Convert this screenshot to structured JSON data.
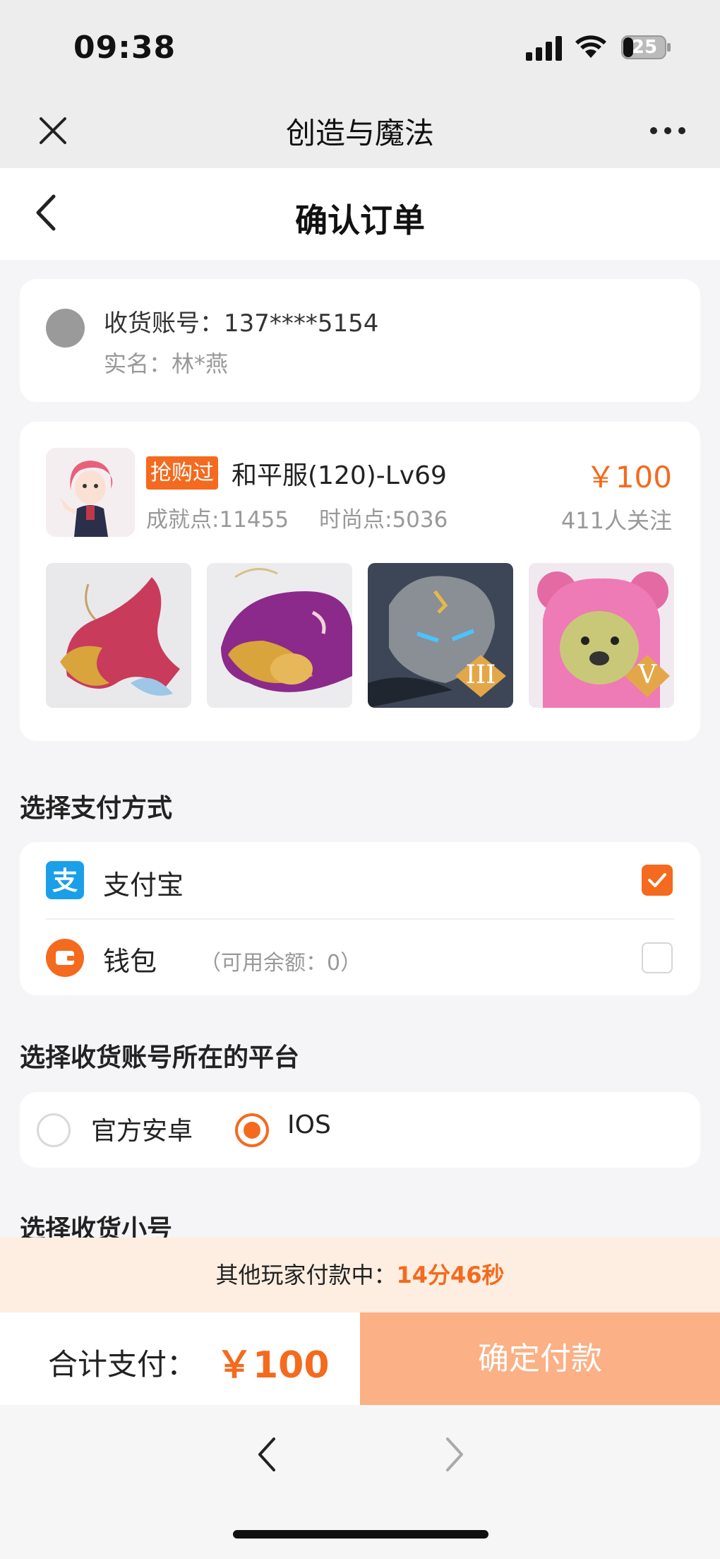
{
  "status": {
    "time": "09:38",
    "battery": "25"
  },
  "wechat": {
    "title": "创造与魔法"
  },
  "page": {
    "title": "确认订单"
  },
  "address": {
    "account": "收货账号：137****5154",
    "realname": "实名：林*燕"
  },
  "product": {
    "tag": "抢购过",
    "title": "和平服(120)-Lv69",
    "price": "￥100",
    "achievement": "成就点:11455",
    "fashion": "时尚点:5036",
    "followers": "411人关注",
    "thumb_badges": [
      "",
      "",
      "III",
      "V"
    ]
  },
  "payment": {
    "section_title": "选择支付方式",
    "options": [
      {
        "label": "支付宝",
        "note": "",
        "checked": true
      },
      {
        "label": "钱包",
        "note": "（可用余额：0）",
        "checked": false
      }
    ]
  },
  "platform": {
    "section_title": "选择收货账号所在的平台",
    "options": [
      {
        "label": "官方安卓",
        "selected": false
      },
      {
        "label": "IOS",
        "selected": true
      }
    ]
  },
  "subaccount": {
    "section_title": "选择收货小号"
  },
  "banner": {
    "text": "其他玩家付款中：",
    "countdown": "14分46秒"
  },
  "footer": {
    "total_label": "合计支付：",
    "total_value": "￥100",
    "confirm": "确定付款"
  },
  "colors": {
    "accent": "#f46a1e",
    "button": "#fbb085",
    "alipay": "#1a9fe8"
  },
  "icons": [
    "close-icon",
    "more-icon",
    "back-icon",
    "alipay-icon",
    "wallet-icon",
    "check-icon",
    "chevron-left-icon",
    "chevron-right-icon"
  ]
}
